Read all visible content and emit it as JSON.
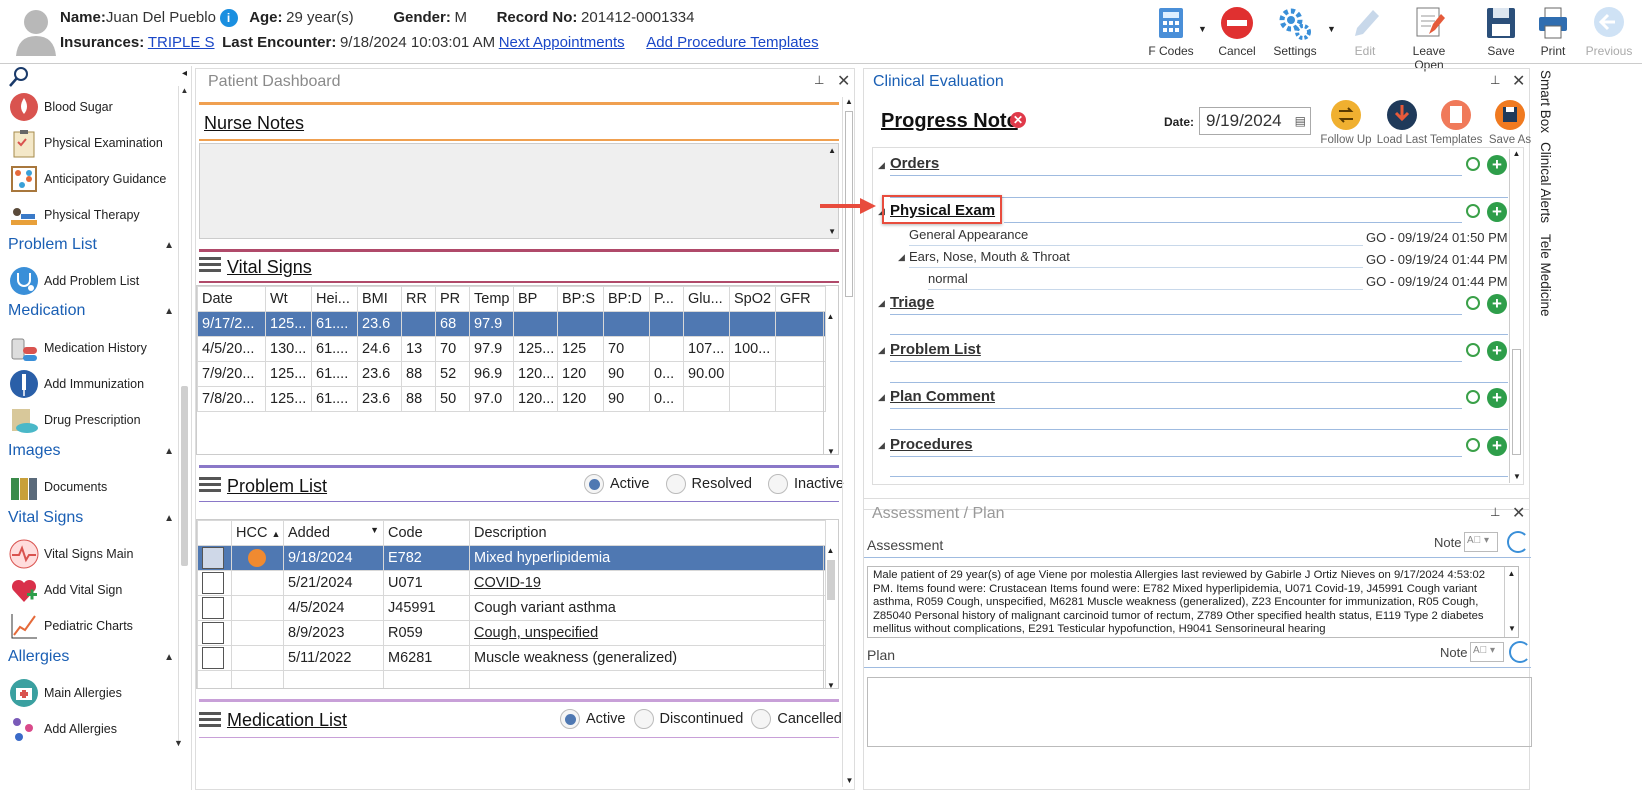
{
  "header": {
    "name_label": "Name:",
    "name": "Juan Del Pueblo",
    "age_label": "Age:",
    "age": "29 year(s)",
    "gender_label": "Gender:",
    "gender": "M",
    "record_label": "Record No:",
    "record": "201412-0001334",
    "insurances_label": "Insurances:",
    "insurance": "TRIPLE S",
    "last_encounter_label": "Last Encounter:",
    "last_encounter": "9/18/2024 10:03:01 AM",
    "next_appointments": "Next Appointments",
    "add_procedure_templates": "Add Procedure Templates"
  },
  "toolbar": {
    "fcodes": "F Codes",
    "cancel": "Cancel",
    "settings": "Settings",
    "edit": "Edit",
    "leave_open": "Leave Open",
    "save": "Save",
    "print": "Print",
    "previous": "Previous"
  },
  "nav": {
    "items_top": [
      "Blood Sugar",
      "Physical Examination",
      "Anticipatory Guidance",
      "Physical Therapy"
    ],
    "sec_problem": "Problem List",
    "problem_items": [
      "Add Problem List"
    ],
    "sec_medication": "Medication",
    "medication_items": [
      "Medication History",
      "Add Immunization",
      "Drug Prescription"
    ],
    "sec_images": "Images",
    "images_items": [
      "Documents"
    ],
    "sec_vitals": "Vital Signs",
    "vitals_items": [
      "Vital Signs Main",
      "Add Vital Sign",
      "Pediatric Charts"
    ],
    "sec_allergies": "Allergies",
    "allergies_items": [
      "Main Allergies",
      "Add Allergies"
    ]
  },
  "dashboard": {
    "title": "Patient Dashboard",
    "nurse_notes": "Nurse Notes",
    "vital_signs": "Vital Signs",
    "vital_cols": [
      "Date",
      "Wt",
      "Hei...",
      "BMI",
      "RR",
      "PR",
      "Temp",
      "BP",
      "BP:S",
      "BP:D",
      "P...",
      "Glu...",
      "SpO2",
      "GFR"
    ],
    "vital_rows": [
      [
        "9/17/2...",
        "125...",
        "61....",
        "23.6",
        "",
        "68",
        "97.9",
        "",
        "",
        "",
        "",
        "",
        "",
        ""
      ],
      [
        "4/5/20...",
        "130...",
        "61....",
        "24.6",
        "13",
        "70",
        "97.9",
        "125...",
        "125",
        "70",
        "",
        "107...",
        "100...",
        ""
      ],
      [
        "7/9/20...",
        "125...",
        "61....",
        "23.6",
        "88",
        "52",
        "96.9",
        "120...",
        "120",
        "90",
        "0...",
        "90.00",
        "",
        ""
      ],
      [
        "7/8/20...",
        "125...",
        "61....",
        "23.6",
        "88",
        "50",
        "97.0",
        "120...",
        "120",
        "90",
        "0...",
        "",
        "",
        ""
      ]
    ],
    "problem_list": "Problem List",
    "problem_filters": [
      "Active",
      "Resolved",
      "Inactive"
    ],
    "problem_cols": [
      "HCC",
      "Added",
      "Code",
      "Description"
    ],
    "problem_rows": [
      {
        "added": "9/18/2024",
        "code": "E782",
        "desc": "Mixed hyperlipidemia",
        "link": false
      },
      {
        "added": "5/21/2024",
        "code": "U071",
        "desc": "COVID-19",
        "link": true
      },
      {
        "added": "4/5/2024",
        "code": "J45991",
        "desc": "Cough variant asthma",
        "link": false
      },
      {
        "added": "8/9/2023",
        "code": "R059",
        "desc": "Cough, unspecified",
        "link": true
      },
      {
        "added": "5/11/2022",
        "code": "M6281",
        "desc": "Muscle weakness (generalized)",
        "link": false
      }
    ],
    "medication_list": "Medication List",
    "medication_filters": [
      "Active",
      "Discontinued",
      "Cancelled"
    ]
  },
  "clinical": {
    "title": "Clinical Evaluation",
    "note_title": "Progress Note",
    "date_label": "Date:",
    "date": "9/19/2024",
    "actions": [
      "Follow Up",
      "Load Last",
      "Templates",
      "Save As"
    ],
    "sections": [
      "Orders",
      "Physical Exam",
      "Triage",
      "Problem List",
      "Plan Comment",
      "Procedures"
    ],
    "exam_items": [
      {
        "label": "General Appearance",
        "stamp": "GO - 09/19/24 01:50 PM"
      },
      {
        "label": "Ears, Nose, Mouth & Throat",
        "stamp": "GO - 09/19/24 01:44 PM"
      },
      {
        "label": "normal",
        "stamp": "GO - 09/19/24 01:44 PM"
      }
    ]
  },
  "assessment": {
    "title": "Assessment / Plan",
    "assessment_label": "Assessment",
    "note_label": "Note",
    "text": "Male patient of 29 year(s) of age Viene por molestia     Allergies last reviewed by Gabirle J Ortiz Nieves on 9/17/2024 4:53:02 PM.    Items found were:  Crustacean  Items found were:  E782 Mixed hyperlipidemia, U071 Covid-19, J45991 Cough variant asthma, R059 Cough, unspecified, M6281 Muscle weakness (generalized), Z23 Encounter for immunization, R05 Cough, Z85040 Personal history of malignant carcinoid tumor of rectum, Z789 Other specified health status, E119 Type 2 diabetes mellitus without complications, E291 Testicular hypofunction, H9041 Sensorineural hearing",
    "plan_label": "Plan"
  },
  "side_tabs": [
    "Smart Box",
    "Clinical Alerts",
    "Tele Medicine"
  ],
  "colors": {
    "accent": "#1a5fb4",
    "selected_row": "#4f78b2",
    "add_green": "#2e9e4a",
    "highlight_box": "#e84c3d"
  }
}
